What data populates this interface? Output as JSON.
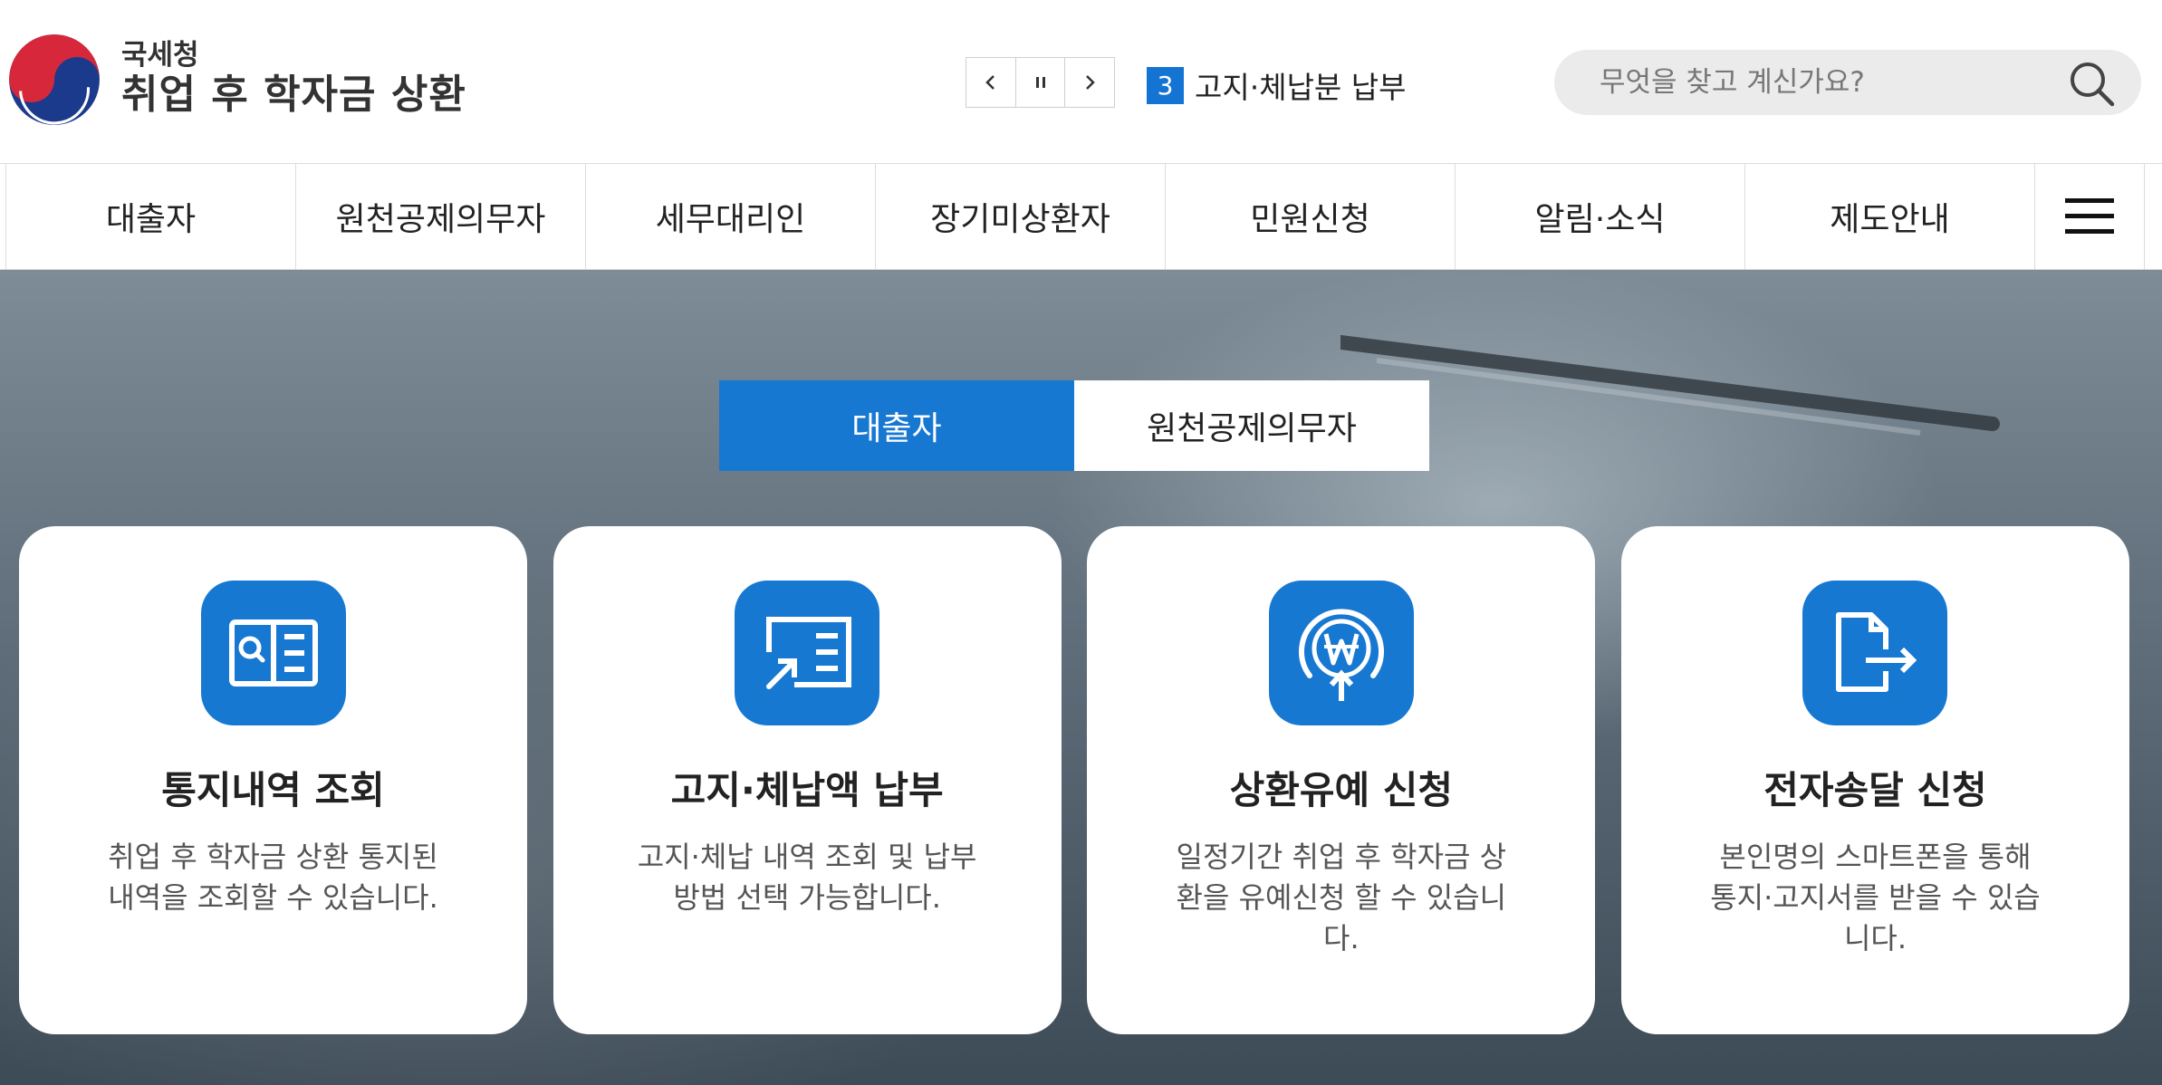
{
  "header": {
    "agency": "국세청",
    "title": "취업 후 학자금 상환",
    "rolling_news": {
      "number": "3",
      "text": "고지·체납분 납부"
    },
    "search": {
      "placeholder": "무엇을 찾고 계신가요?"
    }
  },
  "gnb": {
    "items": [
      {
        "label": "대출자"
      },
      {
        "label": "원천공제의무자"
      },
      {
        "label": "세무대리인"
      },
      {
        "label": "장기미상환자"
      },
      {
        "label": "민원신청"
      },
      {
        "label": "알림·소식"
      },
      {
        "label": "제도안내"
      }
    ]
  },
  "hero": {
    "tabs": [
      {
        "label": "대출자",
        "active": true
      },
      {
        "label": "원천공제의무자",
        "active": false
      }
    ],
    "cards": [
      {
        "title": "통지내역 조회",
        "desc": "취업 후 학자금 상환 통지된 내역을 조회할 수 있습니다.",
        "icon": "document-search-icon"
      },
      {
        "title": "고지·체납액 납부",
        "desc": "고지·체납 내역 조회 및 납부방법 선택 가능합니다.",
        "icon": "document-arrow-icon"
      },
      {
        "title": "상환유예 신청",
        "desc": "일정기간 취업 후 학자금 상환을 유예신청 할 수 있습니다.",
        "icon": "won-deferral-icon"
      },
      {
        "title": "전자송달 신청",
        "desc": "본인명의 스마트폰을 통해 통지·고지서를 받을 수 있습니다.",
        "icon": "file-send-icon"
      }
    ]
  },
  "colors": {
    "accent": "#1778d2",
    "news_badge": "#1474d4",
    "logo_red": "#d6283a",
    "logo_blue": "#1c3a8c"
  }
}
